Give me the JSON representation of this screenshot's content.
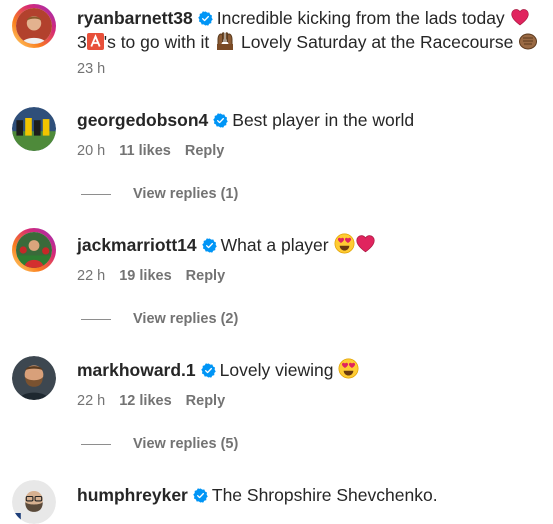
{
  "comments": [
    {
      "username": "ryanbarnett38",
      "text_line1": "Incredible kicking from the lads today",
      "text_line2_pre": "3",
      "text_line2_mid": "'s to go with it",
      "text_line2_post": "Lovely Saturday at the Racecourse",
      "time": "23 h"
    },
    {
      "username": "georgedobson4",
      "text": "Best player in the world",
      "time": "20 h",
      "likes": "11 likes",
      "reply": "Reply",
      "view_replies": "View replies (1)"
    },
    {
      "username": "jackmarriott14",
      "text": "What a player",
      "time": "22 h",
      "likes": "19 likes",
      "reply": "Reply",
      "view_replies": "View replies (2)"
    },
    {
      "username": "markhoward.1",
      "text": "Lovely viewing",
      "time": "22 h",
      "likes": "12 likes",
      "reply": "Reply",
      "view_replies": "View replies (5)"
    },
    {
      "username": "humphreyker",
      "text": "The Shropshire Shevchenko."
    }
  ],
  "icons": {
    "verified_color": "#0095f6",
    "heart_color": "#e0245e",
    "a_button_color": "#e8503a"
  }
}
